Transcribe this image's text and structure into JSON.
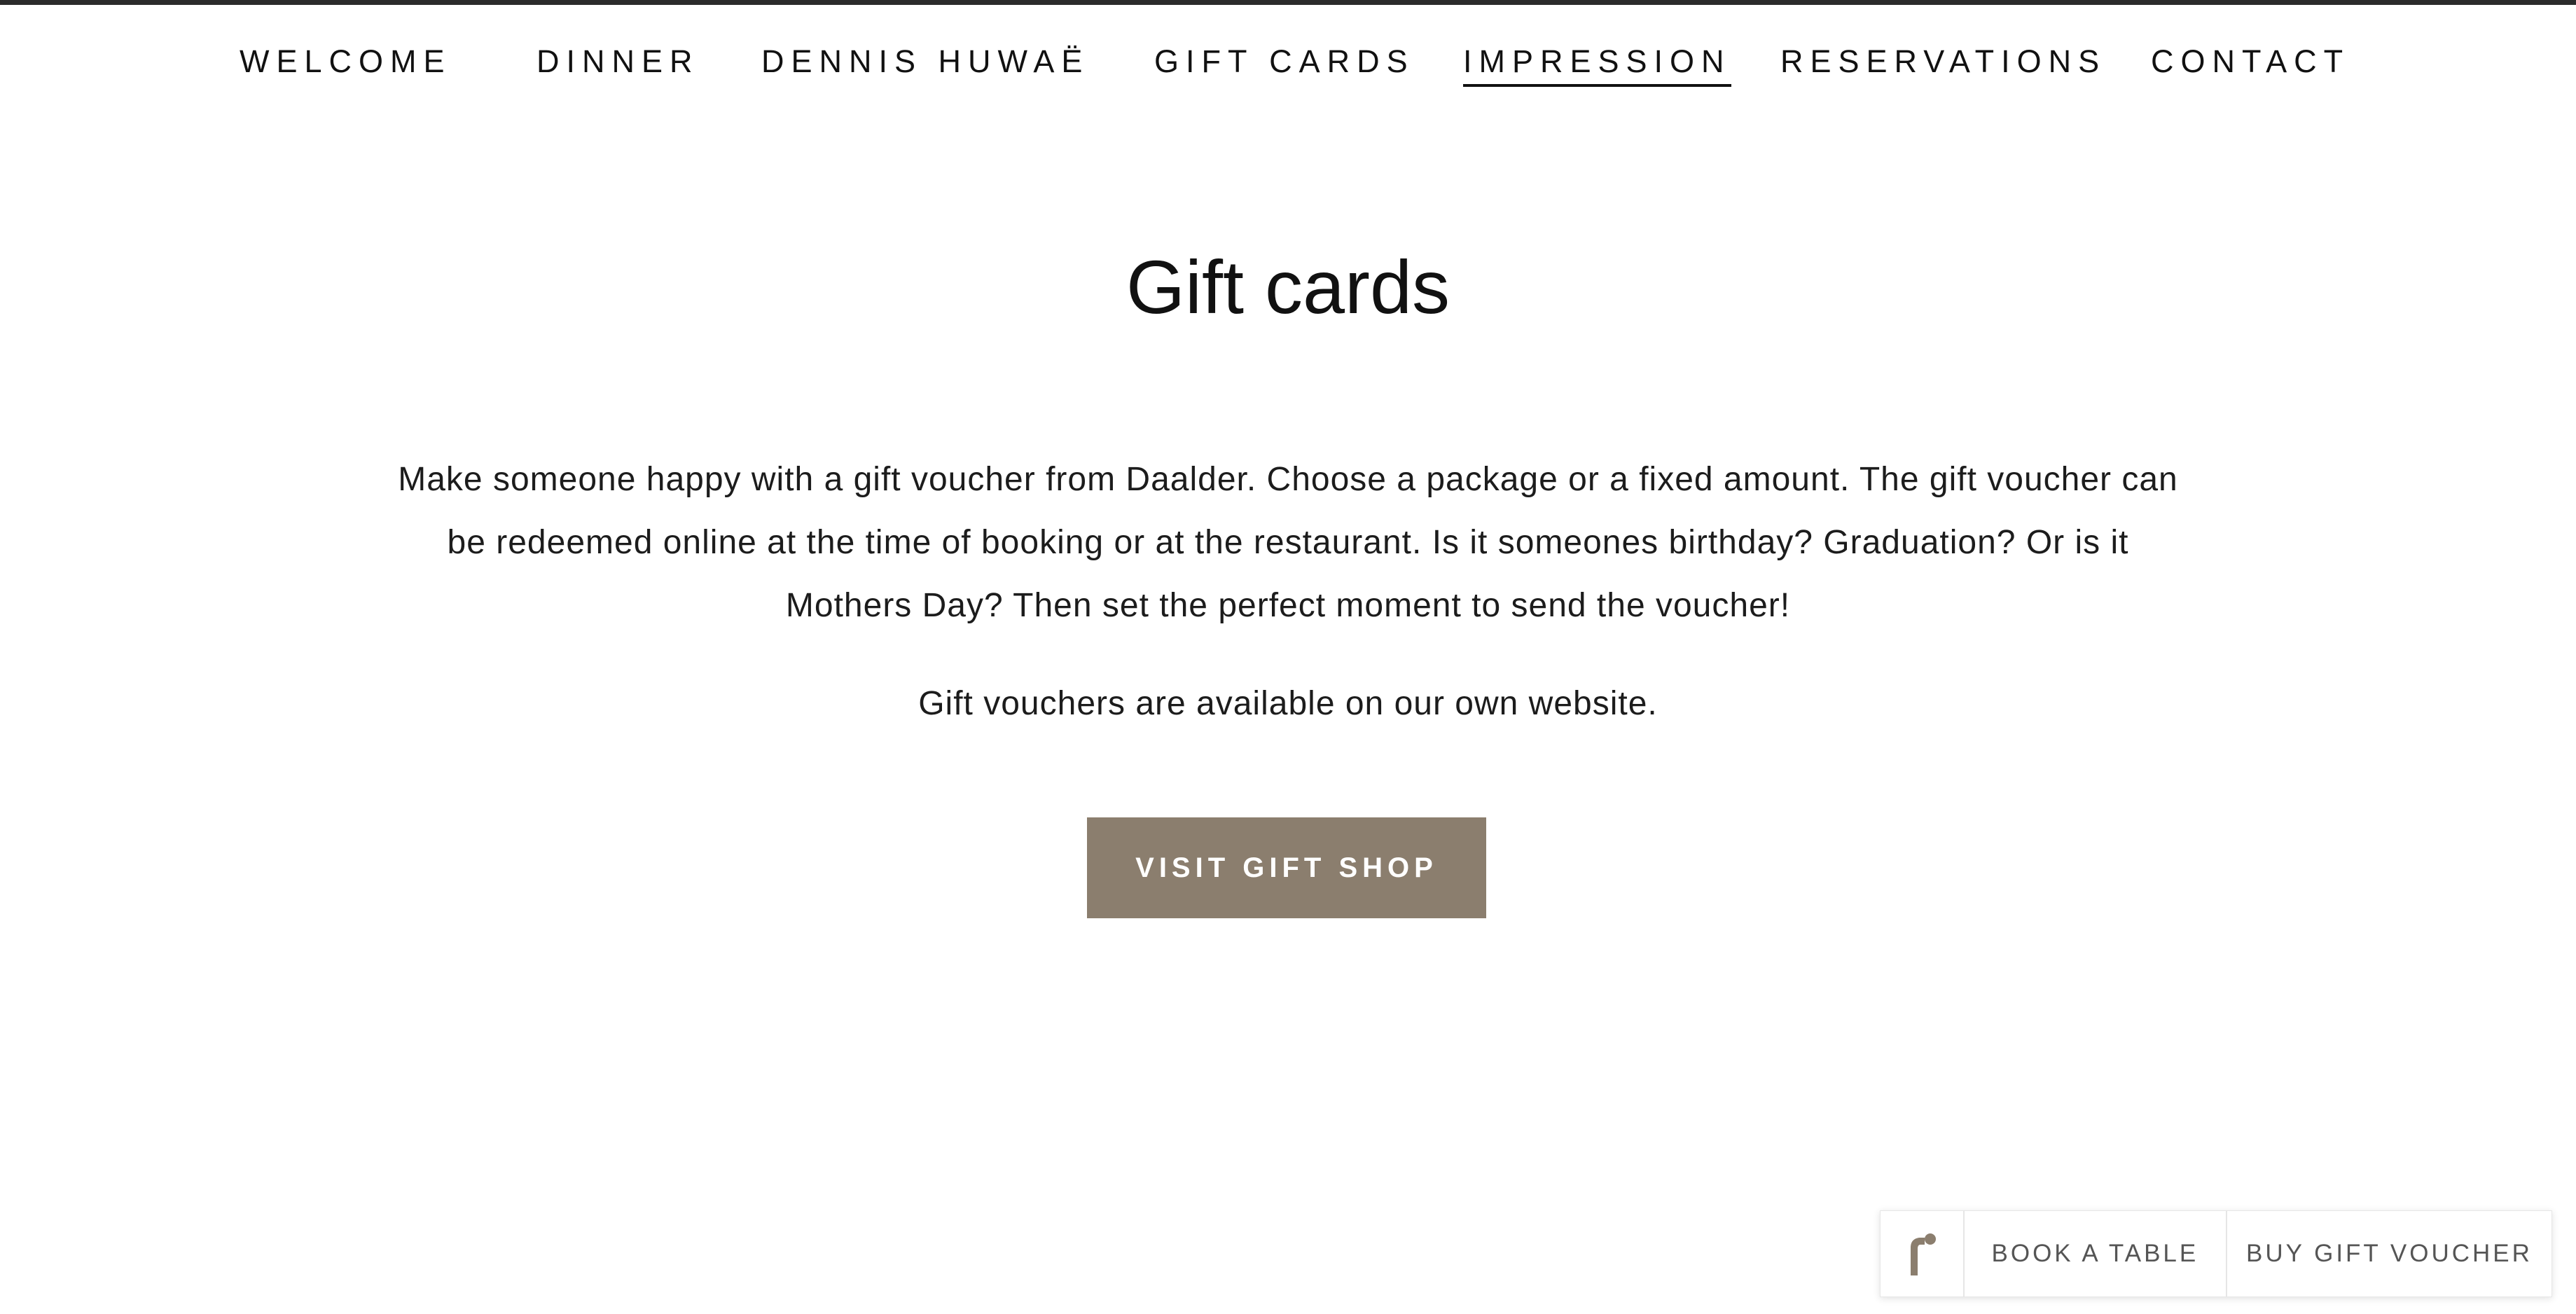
{
  "nav": {
    "items": [
      {
        "label": "WELCOME"
      },
      {
        "label": "DINNER"
      },
      {
        "label": "DENNIS HUWAË"
      },
      {
        "label": "GIFT CARDS"
      },
      {
        "label": "IMPRESSION",
        "active": true
      },
      {
        "label": "RESERVATIONS"
      },
      {
        "label": "CONTACT"
      }
    ]
  },
  "main": {
    "title": "Gift cards",
    "intro_line_1": "Make someone happy with a gift voucher from Daalder. Choose a package or a fixed amount. The gift voucher can",
    "intro_line_2": "be redeemed online at the time of booking or at the restaurant. Is it someones birthday? Graduation? Or is it",
    "intro_line_3": "Mothers Day? Then set the perfect moment to send the voucher!",
    "availability": "Gift vouchers are available on our own website.",
    "cta_label": "VISIT GIFT SHOP"
  },
  "widget": {
    "logo_icon": "formitable-logo-icon",
    "book_label": "BOOK A TABLE",
    "gift_label": "BUY GIFT VOUCHER"
  },
  "colors": {
    "accent": "#8b7e6e",
    "text": "#111111",
    "background": "#ffffff",
    "top_border": "#2b2b2b"
  }
}
